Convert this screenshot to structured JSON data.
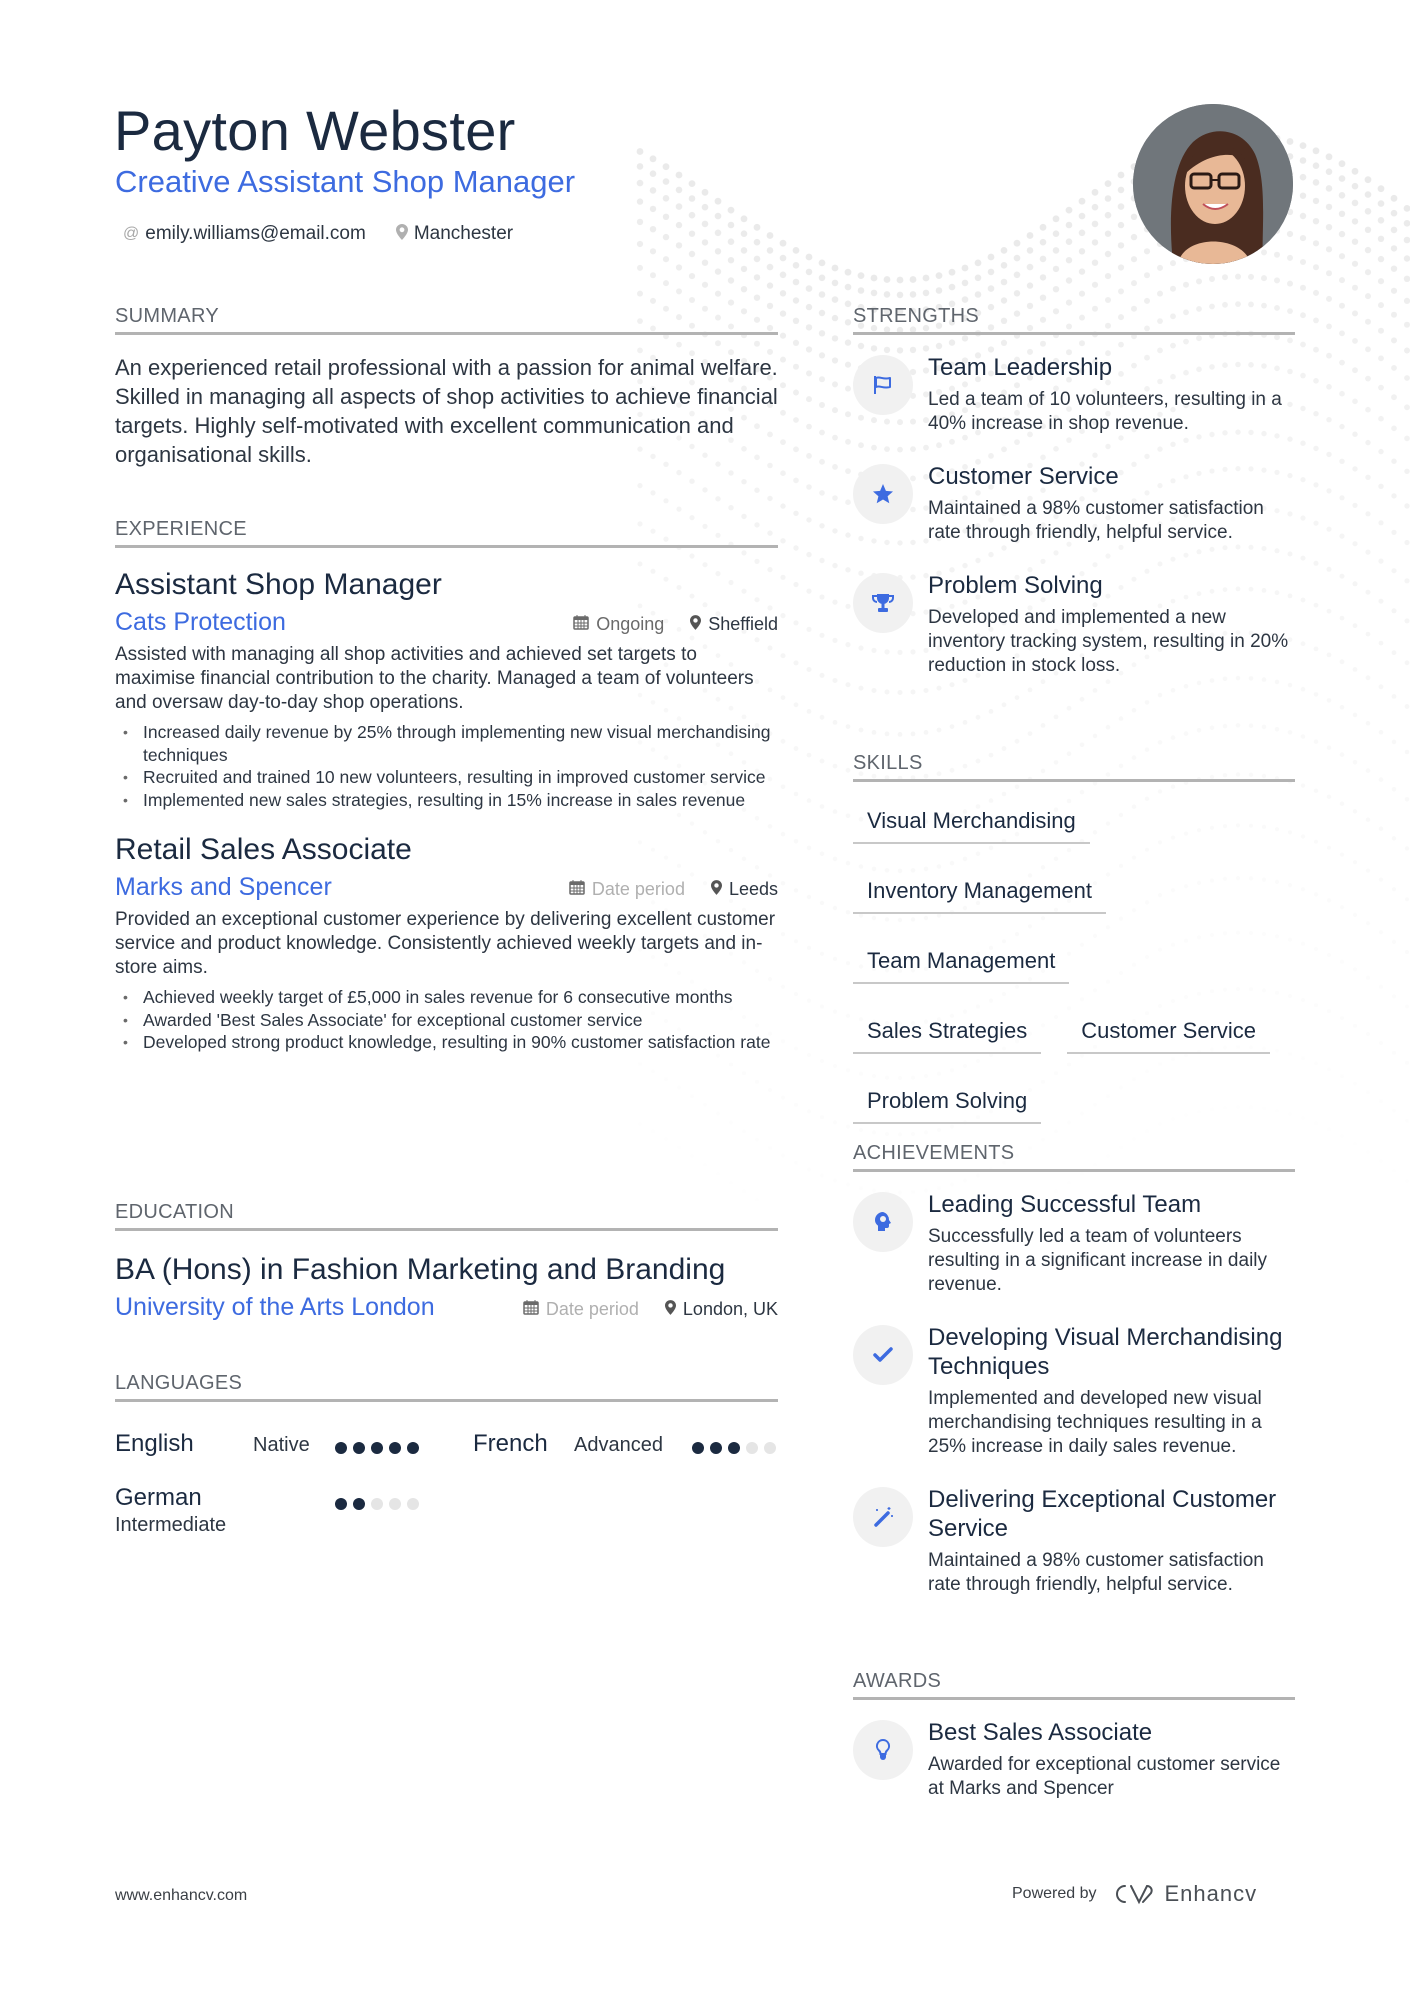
{
  "header": {
    "name": "Payton Webster",
    "headline": "Creative Assistant Shop Manager",
    "email": "emily.williams@email.com",
    "location": "Manchester",
    "email_icon": "at-icon",
    "location_icon": "map-pin-icon"
  },
  "colors": {
    "accent": "#3d6be0",
    "text_dark": "#1b2a40",
    "rule": "#b3b3b3",
    "icon_bg": "#f1f1f1",
    "dot_off": "#e5e5e5"
  },
  "summary": {
    "title": "SUMMARY",
    "text": "An experienced retail professional with a passion for animal welfare. Skilled in managing all aspects of shop activities to achieve financial targets. Highly self-motivated with excellent communication and organisational skills."
  },
  "experience": {
    "title": "EXPERIENCE",
    "jobs": [
      {
        "title": "Assistant Shop Manager",
        "company": "Cats Protection",
        "date": "Ongoing",
        "location": "Sheffield",
        "description": "Assisted with managing all shop activities and achieved set targets to maximise financial contribution to the charity. Managed a team of volunteers and oversaw day-to-day shop operations.",
        "bullets": [
          "Increased daily revenue by 25% through implementing new visual merchandising techniques",
          "Recruited and trained 10 new volunteers, resulting in improved customer service",
          "Implemented new sales strategies, resulting in 15% increase in sales revenue"
        ]
      },
      {
        "title": "Retail Sales Associate",
        "company": "Marks and Spencer",
        "date": "Date period",
        "location": "Leeds",
        "description": "Provided an exceptional customer experience by delivering excellent customer service and product knowledge. Consistently achieved weekly targets and in-store aims.",
        "bullets": [
          "Achieved weekly target of £5,000 in sales revenue for 6 consecutive months",
          "Awarded 'Best Sales Associate' for exceptional customer service",
          "Developed strong product knowledge, resulting in 90% customer satisfaction rate"
        ]
      }
    ]
  },
  "education": {
    "title": "EDUCATION",
    "degree": "BA (Hons) in Fashion Marketing and Branding",
    "school": "University of the Arts London",
    "date": "Date period",
    "location": "London, UK"
  },
  "languages": {
    "title": "LANGUAGES",
    "items": [
      {
        "name": "English",
        "level": "Native",
        "rating": 5,
        "max": 5
      },
      {
        "name": "French",
        "level": "Advanced",
        "rating": 3,
        "max": 5
      },
      {
        "name": "German",
        "level": "Intermediate",
        "rating": 2,
        "max": 5
      }
    ]
  },
  "strengths": {
    "title": "STRENGTHS",
    "items": [
      {
        "icon": "flag-icon",
        "title": "Team Leadership",
        "text": "Led a team of 10 volunteers, resulting in a 40% increase in shop revenue."
      },
      {
        "icon": "star-icon",
        "title": "Customer Service",
        "text": "Maintained a 98% customer satisfaction rate through friendly, helpful service."
      },
      {
        "icon": "trophy-icon",
        "title": "Problem Solving",
        "text": "Developed and implemented a new inventory tracking system, resulting in 20% reduction in stock loss."
      }
    ]
  },
  "skills": {
    "title": "SKILLS",
    "items": [
      "Visual Merchandising",
      "Inventory Management",
      "Team Management",
      "Sales Strategies",
      "Customer Service",
      "Problem Solving"
    ]
  },
  "achievements": {
    "title": "ACHIEVEMENTS",
    "items": [
      {
        "icon": "head-brain-icon",
        "title": "Leading Successful Team",
        "text": "Successfully led a team of volunteers resulting in a significant increase in daily revenue."
      },
      {
        "icon": "check-icon",
        "title": "Developing Visual Merchandising Techniques",
        "text": "Implemented and developed new visual merchandising techniques resulting in a 25% increase in daily sales revenue."
      },
      {
        "icon": "magic-wand-icon",
        "title": "Delivering Exceptional Customer Service",
        "text": "Maintained a 98% customer satisfaction rate through friendly, helpful service."
      }
    ]
  },
  "awards": {
    "title": "AWARDS",
    "items": [
      {
        "icon": "lightbulb-icon",
        "title": "Best Sales Associate",
        "text": "Awarded for exceptional customer service at Marks and Spencer"
      }
    ]
  },
  "footer": {
    "website": "www.enhancv.com",
    "powered_by": "Powered by",
    "brand": "Enhancv"
  }
}
